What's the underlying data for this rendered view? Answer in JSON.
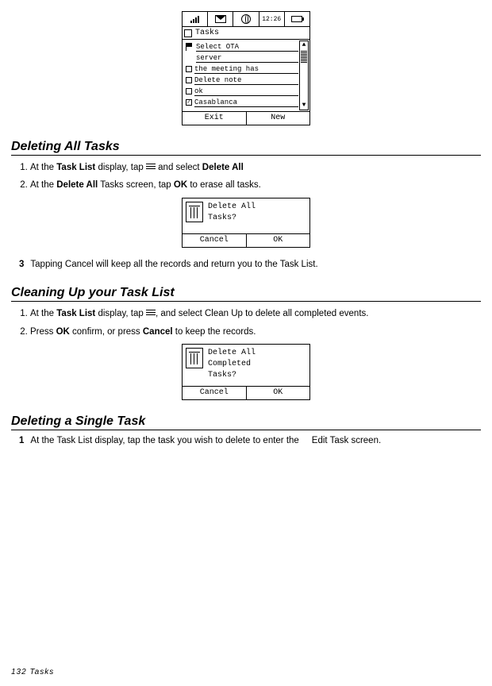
{
  "status": {
    "time": "12:26"
  },
  "tasks_screen": {
    "title": "Tasks",
    "items": [
      "Select OTA",
      "server",
      "the meeting has",
      "Delete note",
      "ok",
      "Casablanca"
    ],
    "softkeys": {
      "left": "Exit",
      "right": "New"
    }
  },
  "section1": {
    "heading": "Deleting All Tasks",
    "step1_a": "At the ",
    "step1_b": "Task List",
    "step1_c": " display, tap ",
    "step1_d": " and select ",
    "step1_e": "Delete All",
    "step2_a": "At the ",
    "step2_b": "Delete All",
    "step2_c": " Tasks screen, tap ",
    "step2_d": "OK",
    "step2_e": " to erase all tasks.",
    "dialog": {
      "line1": "Delete All",
      "line2": "Tasks?",
      "cancel": "Cancel",
      "ok": "OK"
    },
    "step3": "Tapping Cancel will keep all the records and return you to the Task List."
  },
  "section2": {
    "heading": "Cleaning Up your Task List",
    "step1_a": "At the ",
    "step1_b": "Task List",
    "step1_c": " display, tap ",
    "step1_d": ", and select Clean Up to delete all completed events.",
    "step2_a": "Press ",
    "step2_b": "OK",
    "step2_c": " confirm, or press ",
    "step2_d": "Cancel",
    "step2_e": " to keep the records.",
    "dialog": {
      "line1": "Delete All",
      "line2": "Completed",
      "line3": "Tasks?",
      "cancel": "Cancel",
      "ok": "OK"
    }
  },
  "section3": {
    "heading": "Deleting a Single Task",
    "step1_a": "At the ",
    "step1_b": "Task List",
    "step1_c": " display, tap the task you wish to delete to enter the ",
    "step1_d": "Edit Task",
    "step1_e": " screen."
  },
  "footer": "132  Tasks"
}
